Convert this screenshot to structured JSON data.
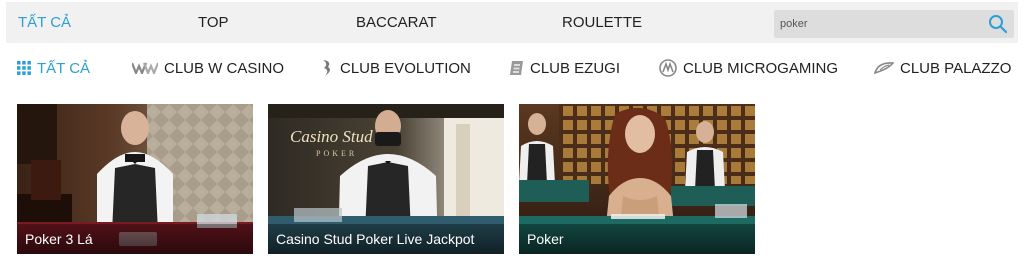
{
  "top_tabs": [
    {
      "label": "TẤT CẢ",
      "active": true
    },
    {
      "label": "TOP",
      "active": false
    },
    {
      "label": "BACCARAT",
      "active": false
    },
    {
      "label": "ROULETTE",
      "active": false
    }
  ],
  "search": {
    "value": "poker",
    "icon": "search-icon"
  },
  "sub_nav": [
    {
      "label": "TẤT CẢ",
      "icon": "grid-icon",
      "active": true
    },
    {
      "label": "CLUB W CASINO",
      "icon": "w-casino-logo-icon",
      "active": false
    },
    {
      "label": "CLUB EVOLUTION",
      "icon": "evolution-logo-icon",
      "active": false
    },
    {
      "label": "CLUB EZUGI",
      "icon": "ezugi-logo-icon",
      "active": false
    },
    {
      "label": "CLUB MICROGAMING",
      "icon": "microgaming-logo-icon",
      "active": false
    },
    {
      "label": "CLUB PALAZZO",
      "icon": "palazzo-logo-icon",
      "active": false
    }
  ],
  "games": [
    {
      "title": "Poker 3 Lá"
    },
    {
      "title": "Casino Stud Poker Live Jackpot",
      "logo_text": "Casino Stud",
      "logo_subtext": "POKER"
    },
    {
      "title": "Poker"
    }
  ],
  "colors": {
    "accent": "#2c9fd6",
    "bar_bg": "#f1f1f1",
    "search_bg": "#dddddd"
  }
}
